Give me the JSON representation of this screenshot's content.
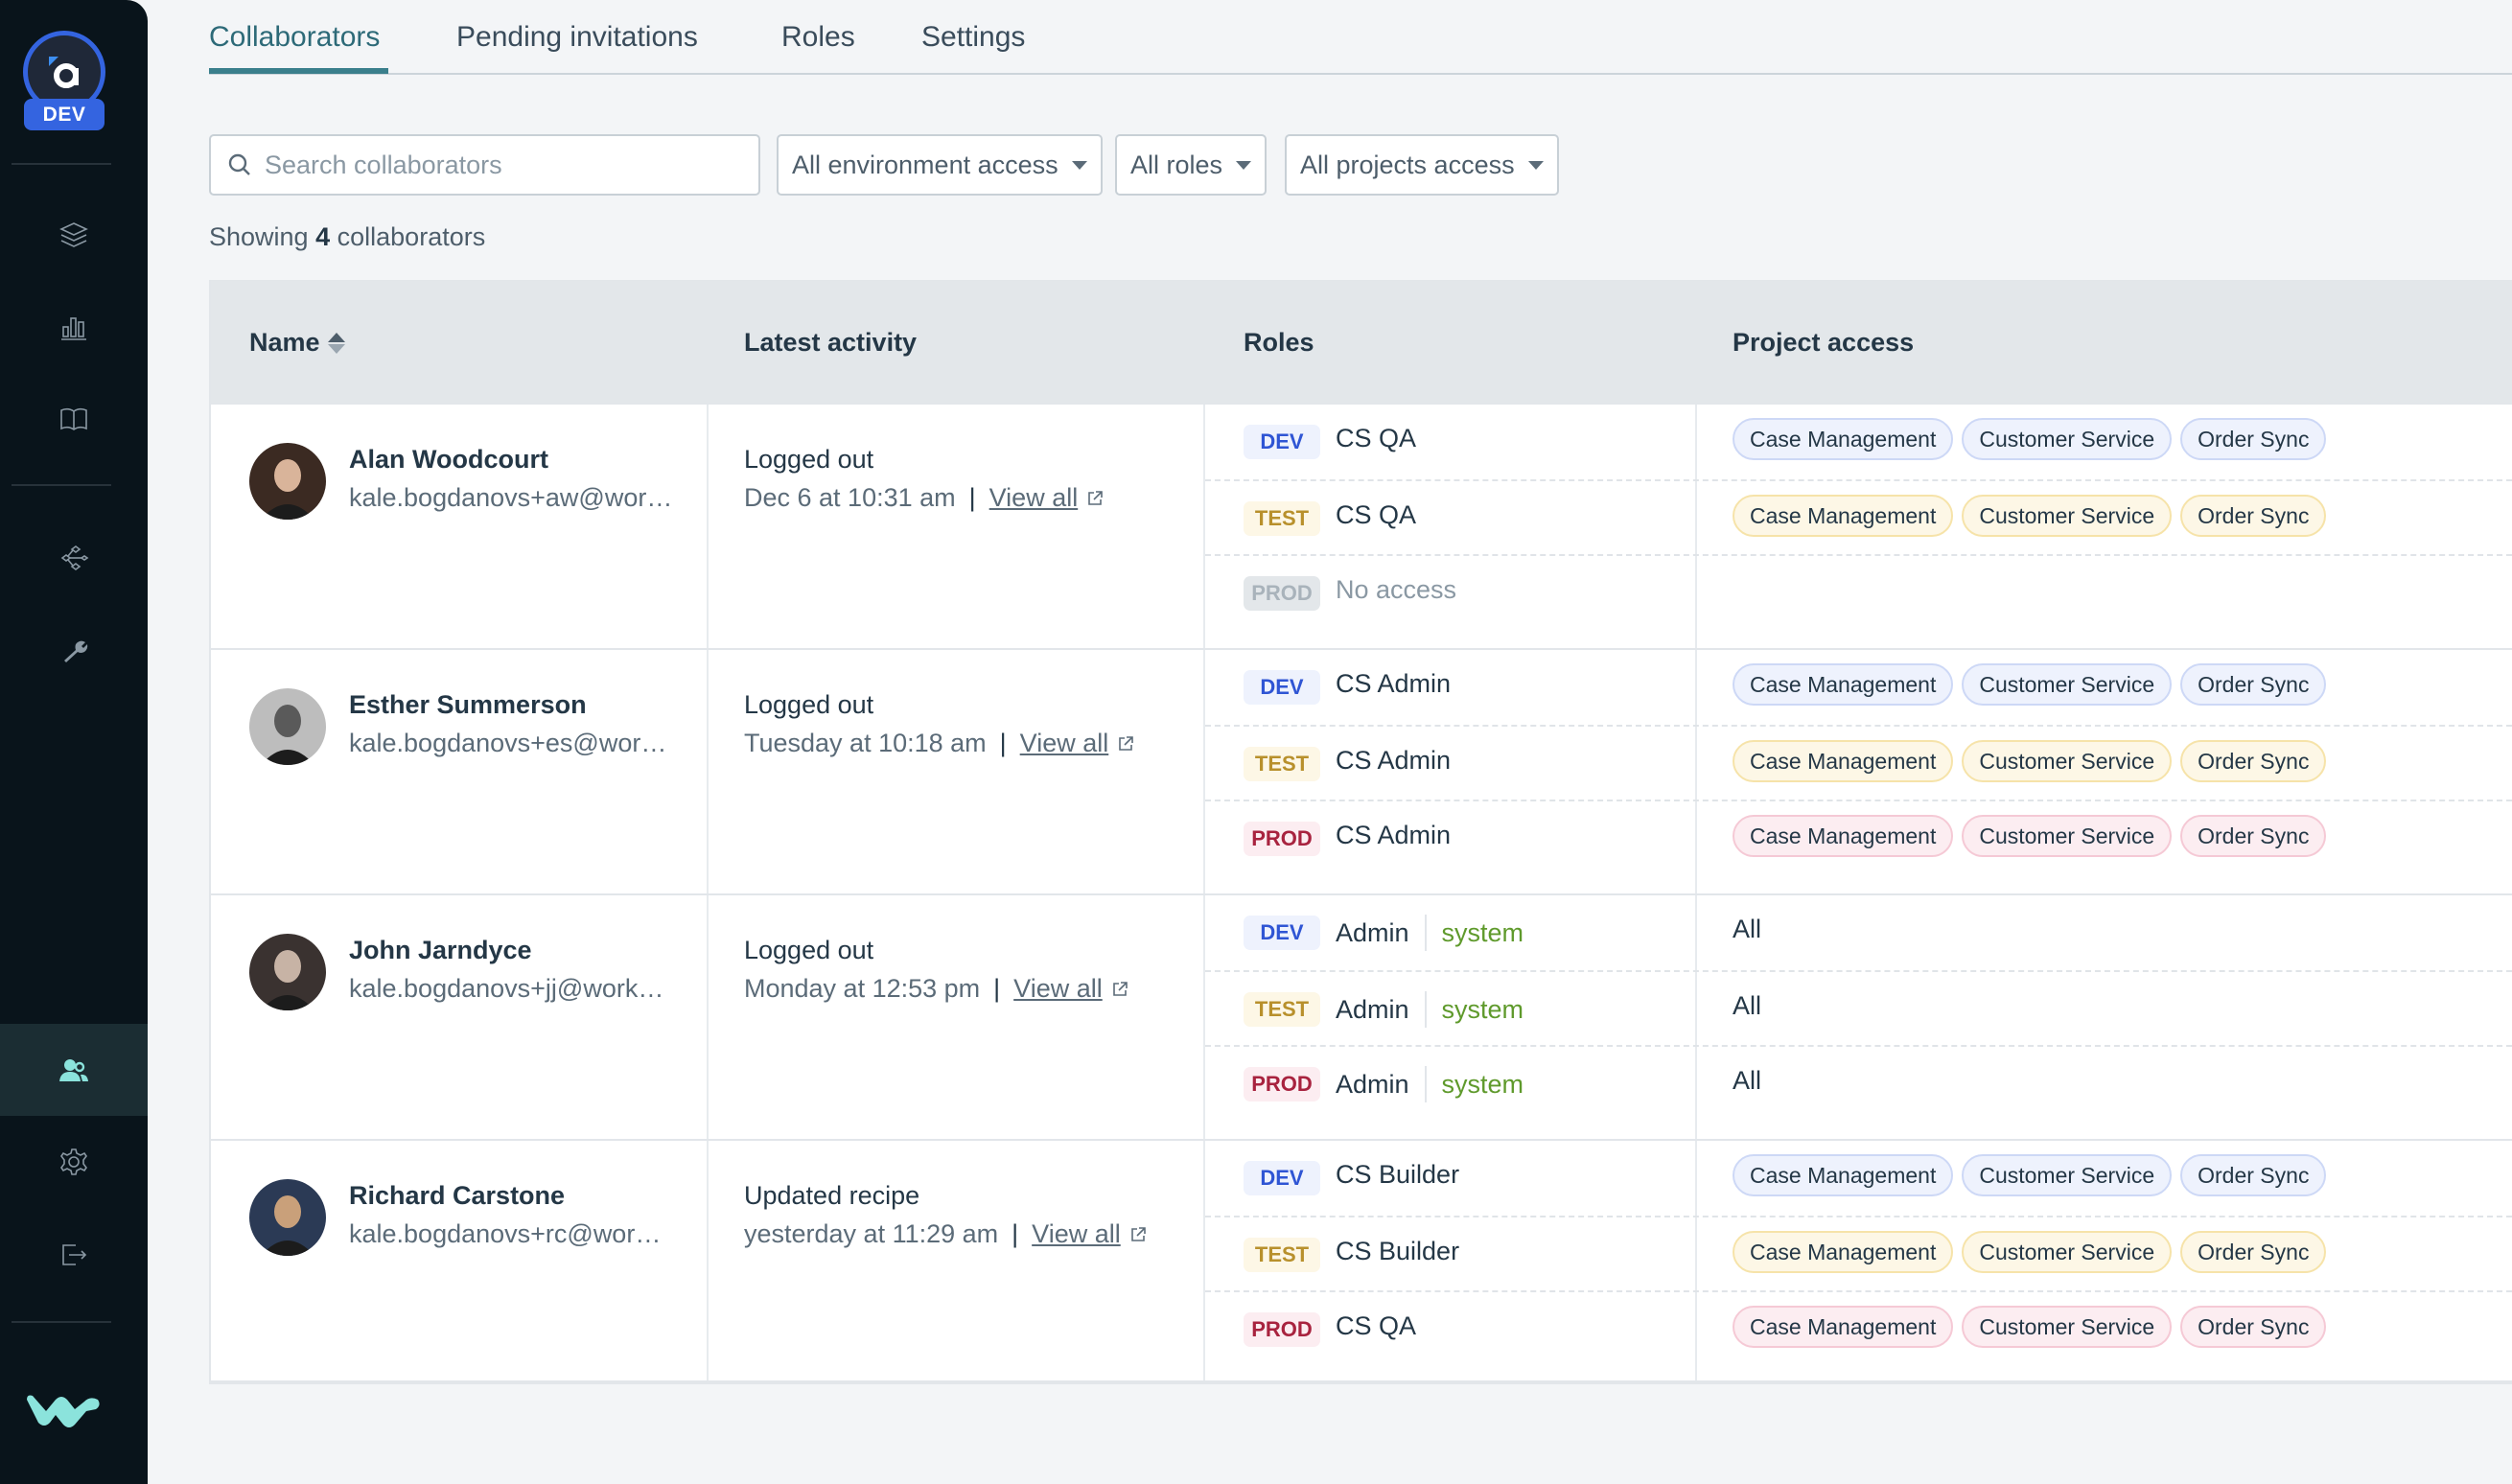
{
  "sidebar": {
    "env_label": "DEV",
    "items": [
      {
        "icon": "layers-icon",
        "label": "Projects"
      },
      {
        "icon": "bar-chart-icon",
        "label": "Dashboard"
      },
      {
        "icon": "book-icon",
        "label": "Docs"
      },
      {
        "icon": "share-nodes-icon",
        "label": "Connections"
      },
      {
        "icon": "wrench-icon",
        "label": "Tools"
      },
      {
        "icon": "users-icon",
        "label": "Collaborators",
        "active": true
      },
      {
        "icon": "gear-icon",
        "label": "Settings"
      },
      {
        "icon": "logout-icon",
        "label": "Sign out"
      }
    ],
    "brand": "workato-logo"
  },
  "tabs": [
    {
      "label": "Collaborators",
      "active": true
    },
    {
      "label": "Pending invitations"
    },
    {
      "label": "Roles"
    },
    {
      "label": "Settings"
    }
  ],
  "filters": {
    "search_placeholder": "Search collaborators",
    "search_value": "",
    "environment": "All environment access",
    "roles": "All roles",
    "projects": "All projects access"
  },
  "summary": {
    "prefix": "Showing",
    "count": "4",
    "suffix": "collaborators"
  },
  "table": {
    "headers": {
      "name": "Name",
      "activity": "Latest activity",
      "roles": "Roles",
      "projects": "Project access"
    },
    "rows": [
      {
        "name": "Alan Woodcourt",
        "email": "kale.bogdanovs+aw@wor…",
        "activity": "Logged out",
        "activity_time": "Dec 6 at 10:31 am",
        "view_all": "View all",
        "envs": [
          {
            "env": "DEV",
            "kind": "dev",
            "role": "CS QA",
            "projects": [
              "Case Management",
              "Customer Service",
              "Order Sync"
            ]
          },
          {
            "env": "TEST",
            "kind": "test",
            "role": "CS QA",
            "projects": [
              "Case Management",
              "Customer Service",
              "Order Sync"
            ]
          },
          {
            "env": "PROD",
            "kind": "off",
            "role": "No access",
            "muted": true,
            "projects": []
          }
        ]
      },
      {
        "name": "Esther Summerson",
        "email": "kale.bogdanovs+es@wor…",
        "activity": "Logged out",
        "activity_time": "Tuesday at 10:18 am",
        "view_all": "View all",
        "envs": [
          {
            "env": "DEV",
            "kind": "dev",
            "role": "CS Admin",
            "projects": [
              "Case Management",
              "Customer Service",
              "Order Sync"
            ]
          },
          {
            "env": "TEST",
            "kind": "test",
            "role": "CS Admin",
            "projects": [
              "Case Management",
              "Customer Service",
              "Order Sync"
            ]
          },
          {
            "env": "PROD",
            "kind": "prod",
            "role": "CS Admin",
            "projects": [
              "Case Management",
              "Customer Service",
              "Order Sync"
            ]
          }
        ]
      },
      {
        "name": "John Jarndyce",
        "email": "kale.bogdanovs+jj@work…",
        "activity": "Logged out",
        "activity_time": "Monday at 12:53 pm",
        "view_all": "View all",
        "envs": [
          {
            "env": "DEV",
            "kind": "dev",
            "role": "Admin",
            "system": "system",
            "projects_all": "All"
          },
          {
            "env": "TEST",
            "kind": "test",
            "role": "Admin",
            "system": "system",
            "projects_all": "All"
          },
          {
            "env": "PROD",
            "kind": "prod",
            "role": "Admin",
            "system": "system",
            "projects_all": "All"
          }
        ]
      },
      {
        "name": "Richard Carstone",
        "email": "kale.bogdanovs+rc@wor…",
        "activity": "Updated recipe",
        "activity_time": "yesterday at 11:29 am",
        "view_all": "View all",
        "envs": [
          {
            "env": "DEV",
            "kind": "dev",
            "role": "CS Builder",
            "projects": [
              "Case Management",
              "Customer Service",
              "Order Sync"
            ]
          },
          {
            "env": "TEST",
            "kind": "test",
            "role": "CS Builder",
            "projects": [
              "Case Management",
              "Customer Service",
              "Order Sync"
            ]
          },
          {
            "env": "PROD",
            "kind": "prod",
            "role": "CS QA",
            "projects": [
              "Case Management",
              "Customer Service",
              "Order Sync"
            ]
          }
        ]
      }
    ]
  },
  "colors": {
    "sidebar_bg": "#09141b",
    "accent": "#3a7f8c",
    "env_dev": "#2f55d4",
    "env_test": "#b8902c",
    "env_prod": "#a8233f",
    "system": "#5f9a2c",
    "active_icon": "#8be3dc"
  }
}
